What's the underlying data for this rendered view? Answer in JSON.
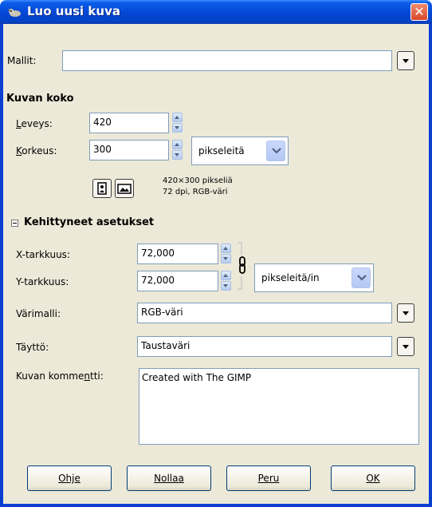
{
  "window": {
    "title": "Luo uusi kuva",
    "close_glyph": "✕",
    "title_icon": "gimp-wilber-icon"
  },
  "templates": {
    "label": "Mallit:",
    "value": ""
  },
  "image_size": {
    "heading": "Kuvan koko",
    "width_label": "Leveys:",
    "width_value": "420",
    "height_label": "Korkeus:",
    "height_value": "300",
    "unit": "pikseleitä",
    "info_line1": "420×300 pikseliä",
    "info_line2": "72 dpi, RGB-väri"
  },
  "advanced": {
    "heading": "Kehittyneet asetukset",
    "x_res_label": "X-tarkkuus:",
    "x_res_value": "72,000",
    "y_res_label": "Y-tarkkuus:",
    "y_res_value": "72,000",
    "res_unit": "pikseleitä/in",
    "colorspace_label": "Värimalli:",
    "colorspace_value": "RGB-väri",
    "fill_label": "Täyttö:",
    "fill_value": "Taustaväri",
    "comment_label": "Kuvan kommentti:",
    "comment_value": "Created with The GIMP"
  },
  "buttons": {
    "help": "Ohje",
    "reset": "Nollaa",
    "cancel": "Peru",
    "ok": "OK"
  },
  "colors": {
    "titlebar": "#0547d6",
    "dialog_bg": "#ece9d8",
    "close": "#d9482a"
  }
}
